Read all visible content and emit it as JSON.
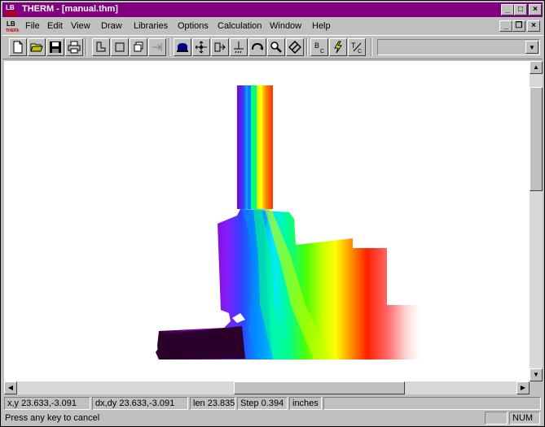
{
  "window": {
    "title": "THERM - [manual.thm]",
    "icon": "therm-app-icon",
    "title_bar_color": "#800080"
  },
  "menu": {
    "items": [
      {
        "label": "File"
      },
      {
        "label": "Edit"
      },
      {
        "label": "View"
      },
      {
        "label": "Draw"
      },
      {
        "label": "Libraries"
      },
      {
        "label": "Options"
      },
      {
        "label": "Calculation"
      },
      {
        "label": "Window"
      },
      {
        "label": "Help"
      }
    ]
  },
  "toolbar": {
    "buttons": [
      {
        "name": "new-file-icon"
      },
      {
        "name": "open-folder-icon"
      },
      {
        "name": "save-disk-icon"
      },
      {
        "name": "print-icon"
      },
      {
        "name": "draw-polygon-icon"
      },
      {
        "name": "draw-rectangle-icon"
      },
      {
        "name": "copy-polygon-icon"
      },
      {
        "name": "locate-point-icon"
      },
      {
        "name": "fill-void-icon"
      },
      {
        "name": "insert-point-icon"
      },
      {
        "name": "move-point-icon"
      },
      {
        "name": "offset-icon"
      },
      {
        "name": "rotate-icon"
      },
      {
        "name": "zoom-icon"
      },
      {
        "name": "flip-icon"
      },
      {
        "name": "boundary-conditions-icon",
        "text": "B",
        "sub": "C"
      },
      {
        "name": "calculate-lightning-icon"
      },
      {
        "name": "temperature-icon",
        "text": "T",
        "sub": "C"
      }
    ],
    "combo_value": ""
  },
  "status": {
    "xy": "x,y 23.633,-3.091",
    "dxdy": "dx,dy 23.633,-3.091",
    "len": "len 23.835",
    "step": "Step 0.394",
    "units": "inches",
    "message": "Press any key to cancel",
    "num": "NUM"
  },
  "colors": {
    "isotherm_gradient": [
      "#3a003a",
      "#8000a0",
      "#5030ff",
      "#0080ff",
      "#00e0ff",
      "#00ff80",
      "#40ff00",
      "#c0ff00",
      "#ffff00",
      "#ff8000",
      "#ff2000",
      "#ff6060",
      "#ffd0d0",
      "#ffffff"
    ]
  }
}
